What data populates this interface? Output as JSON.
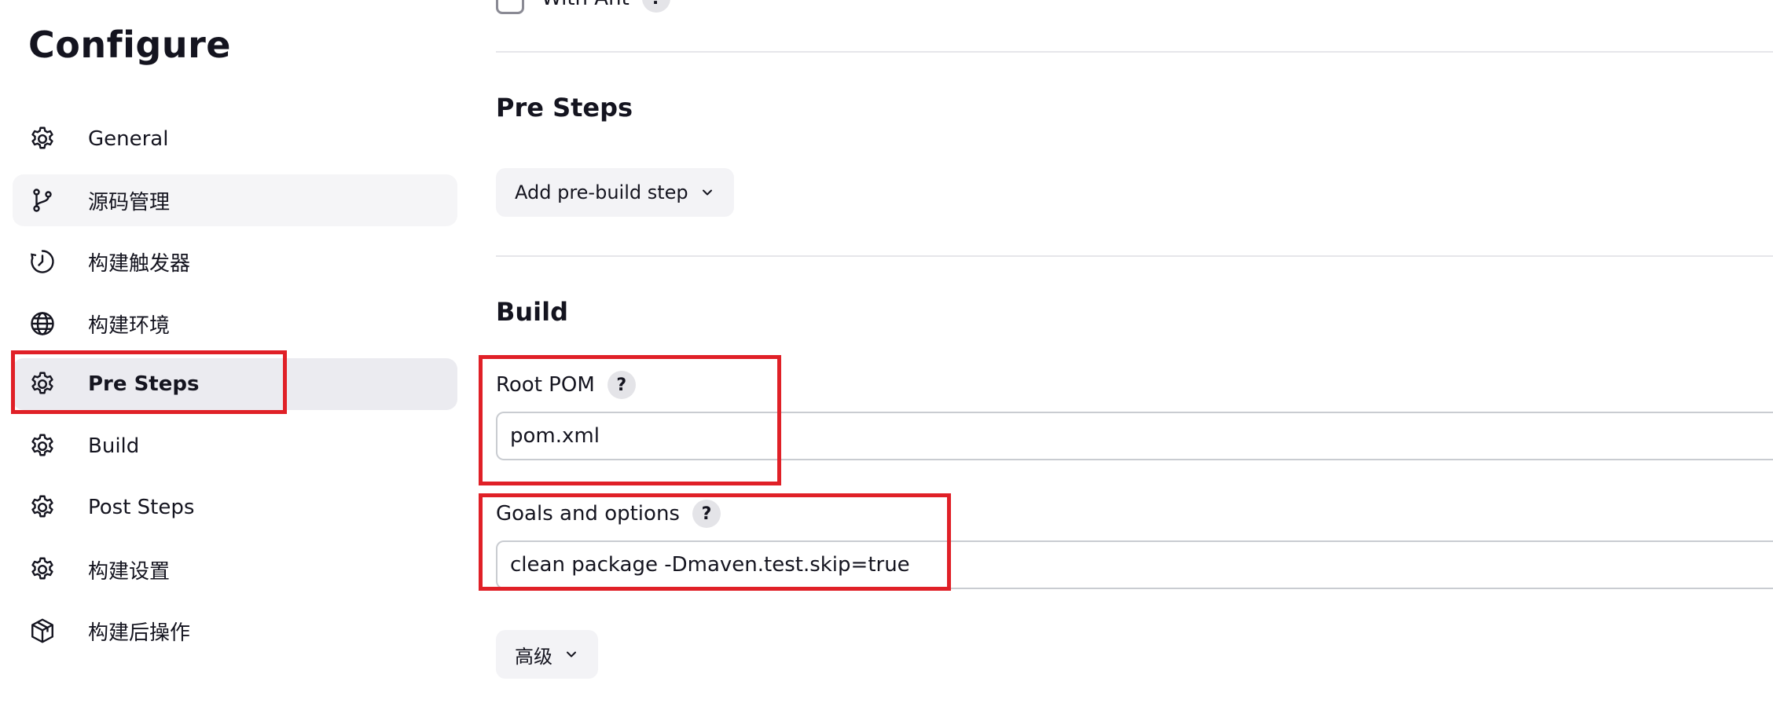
{
  "sidebar": {
    "title": "Configure",
    "items": [
      {
        "label": "General",
        "icon": "gear-icon"
      },
      {
        "label": "源码管理",
        "icon": "git-branch-icon"
      },
      {
        "label": "构建触发器",
        "icon": "clock-icon"
      },
      {
        "label": "构建环境",
        "icon": "globe-icon"
      },
      {
        "label": "Pre Steps",
        "icon": "gear-icon"
      },
      {
        "label": "Build",
        "icon": "gear-icon"
      },
      {
        "label": "Post Steps",
        "icon": "gear-icon"
      },
      {
        "label": "构建设置",
        "icon": "gear-icon"
      },
      {
        "label": "构建后操作",
        "icon": "package-icon"
      }
    ],
    "active_item": "Pre Steps"
  },
  "main": {
    "with_ant": {
      "label": "With Ant",
      "help": "?"
    },
    "pre_steps": {
      "title": "Pre Steps",
      "add_button": "Add pre-build step"
    },
    "build": {
      "title": "Build",
      "root_pom": {
        "label": "Root POM",
        "help": "?",
        "value": "pom.xml"
      },
      "goals": {
        "label": "Goals and options",
        "help": "?",
        "value": "clean package -Dmaven.test.skip=true"
      },
      "advanced_button": "高级"
    }
  },
  "colors": {
    "highlight": "#e02027",
    "active_bg": "#ebebf0",
    "button_bg": "#f3f3f6"
  }
}
